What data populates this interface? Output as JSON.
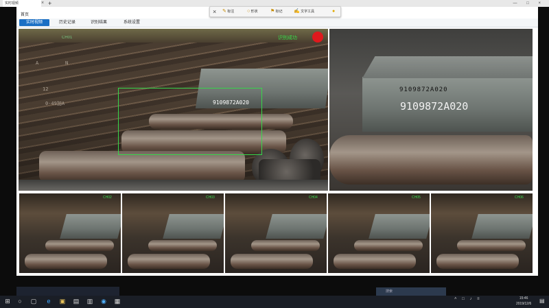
{
  "browser": {
    "tab_title": "实时视频",
    "tab_close": "×",
    "new_tab": "+",
    "window_controls": "— □ ×"
  },
  "app": {
    "title": "首页",
    "nav_tabs": [
      {
        "label": "实时视频"
      },
      {
        "label": "历史记录"
      },
      {
        "label": "识别结果"
      },
      {
        "label": "系统设置"
      }
    ]
  },
  "toolbar": {
    "close_icon": "×",
    "items": [
      {
        "icon": "pen-icon",
        "glyph": "✎",
        "label": "标注"
      },
      {
        "icon": "shape-icon",
        "glyph": "○",
        "label": "形状"
      },
      {
        "icon": "stamp-icon",
        "glyph": "⚑",
        "label": "标记"
      },
      {
        "icon": "text-icon",
        "glyph": "✍",
        "label": "文字工具"
      }
    ],
    "end_glyph": "●"
  },
  "cameras": {
    "main": {
      "status": "识别成功",
      "overlay": "CH01",
      "plate_id": "9109872A020",
      "chalk_marks": [
        "A",
        "N",
        "0-49加A",
        "12"
      ]
    },
    "zoom": {
      "plate_stamp": "9109872A020",
      "plate_id": "9109872A020"
    },
    "thumbnails": [
      {
        "label": "CH02"
      },
      {
        "label": "CH03"
      },
      {
        "label": "CH04"
      },
      {
        "label": "CH05"
      },
      {
        "label": "CH06"
      }
    ]
  },
  "taskbar": {
    "start_glyph": "⊞",
    "icons": [
      "○",
      "▢",
      "e",
      "▣",
      "▤",
      "▥",
      "◉",
      "▦"
    ],
    "search_placeholder": "搜索",
    "tray": "˄ □ ♪ ≡",
    "time": "15:46",
    "date": "2019/12/6",
    "notification": "▤"
  },
  "colors": {
    "accent": "#1b6fc4",
    "status_green": "#36e04a",
    "alert_red": "#e0191d"
  }
}
